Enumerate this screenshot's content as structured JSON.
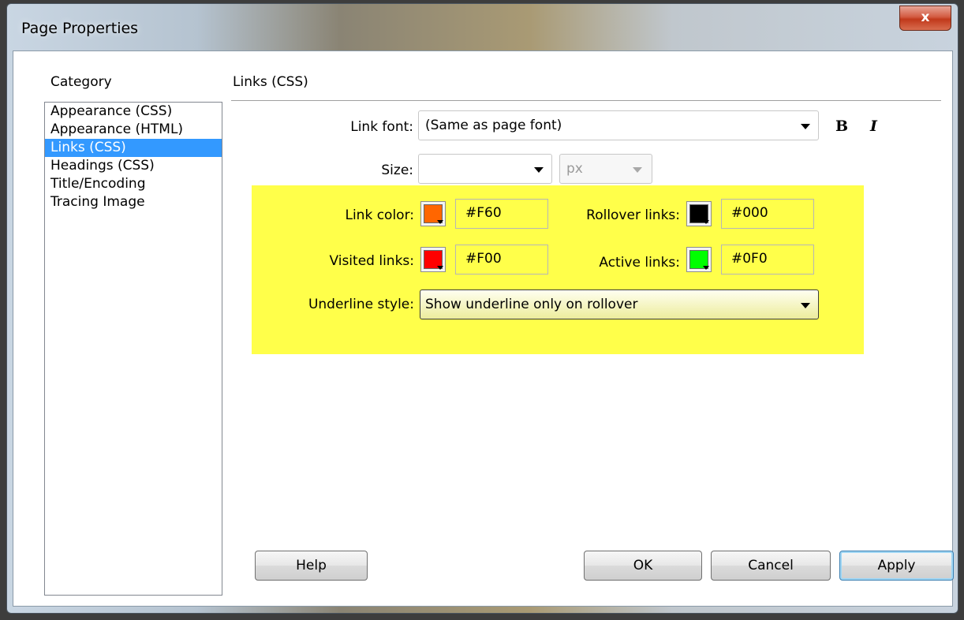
{
  "window": {
    "title": "Page Properties",
    "close_label": "x"
  },
  "category": {
    "label": "Category",
    "items": [
      {
        "label": "Appearance (CSS)",
        "selected": false
      },
      {
        "label": "Appearance (HTML)",
        "selected": false
      },
      {
        "label": "Links (CSS)",
        "selected": true
      },
      {
        "label": "Headings (CSS)",
        "selected": false
      },
      {
        "label": "Title/Encoding",
        "selected": false
      },
      {
        "label": "Tracing Image",
        "selected": false
      }
    ]
  },
  "section": {
    "title": "Links (CSS)"
  },
  "link_font": {
    "label": "Link font:",
    "value": "(Same as page font)",
    "bold_label": "B",
    "italic_label": "I"
  },
  "size": {
    "label": "Size:",
    "value": "",
    "unit": "px"
  },
  "colors": {
    "link_color": {
      "label": "Link color:",
      "hex": "#F60",
      "swatch": "#ff6600"
    },
    "rollover_links": {
      "label": "Rollover links:",
      "hex": "#000",
      "swatch": "#000000"
    },
    "visited_links": {
      "label": "Visited links:",
      "hex": "#F00",
      "swatch": "#ff0000"
    },
    "active_links": {
      "label": "Active links:",
      "hex": "#0F0",
      "swatch": "#00ff00"
    }
  },
  "underline": {
    "label": "Underline style:",
    "value": "Show underline only on rollover"
  },
  "buttons": {
    "help": "Help",
    "ok": "OK",
    "cancel": "Cancel",
    "apply": "Apply"
  },
  "theme": {
    "highlight": "#ffff4a",
    "selection": "#3399ff"
  }
}
